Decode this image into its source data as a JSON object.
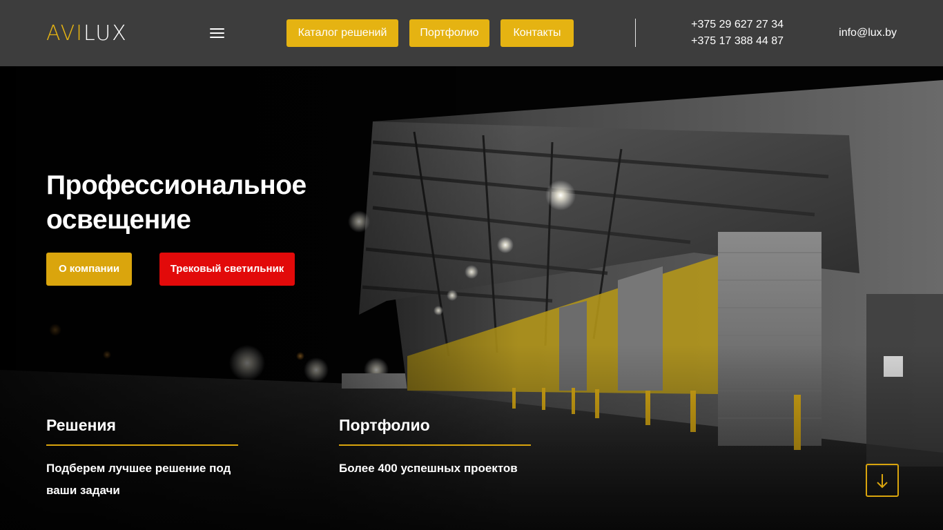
{
  "header": {
    "logo": {
      "left": "AVI",
      "right": "LUX"
    },
    "menu_icon": "hamburger-menu-icon",
    "nav": [
      {
        "label": "Каталог решений"
      },
      {
        "label": "Портфолио"
      },
      {
        "label": "Контакты"
      }
    ],
    "phones": [
      "+375 29 627 27 34",
      "+375 17 388 44 87"
    ],
    "email": "info@lux.by"
  },
  "hero": {
    "title": "Профессиональное освещение",
    "buttons": {
      "about": "О компании",
      "track": "Трековый светильник"
    },
    "features": [
      {
        "title": "Решения",
        "text": "Подберем лучшее решение под ваши задачи"
      },
      {
        "title": "Портфолио",
        "text": "Более 400 успешных проектов"
      }
    ],
    "scroll_icon": "arrow-down-icon"
  },
  "colors": {
    "header_bg": "#3d3d3d",
    "accent_yellow": "#e5b312",
    "button_red": "#e20a0a",
    "text": "#ffffff"
  }
}
